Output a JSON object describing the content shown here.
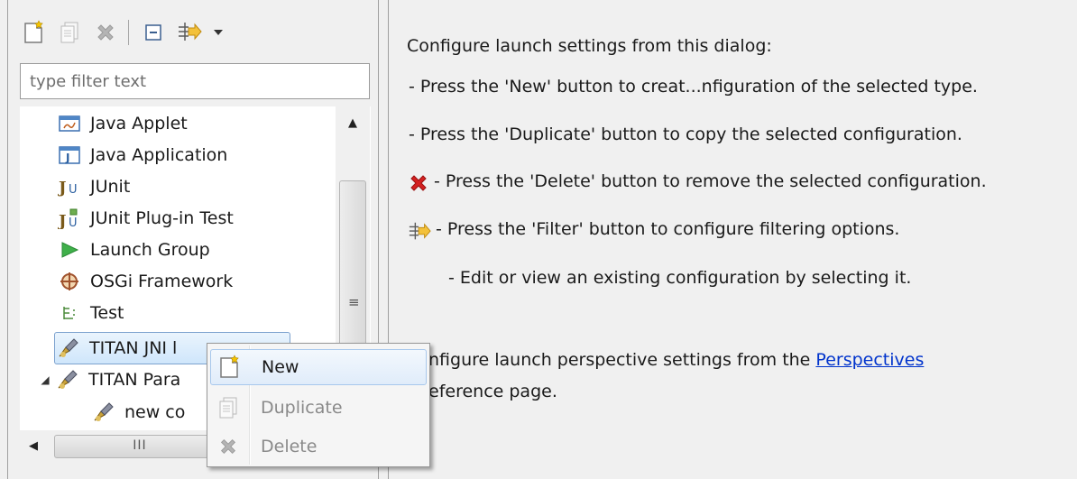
{
  "toolbar": {
    "buttons": [
      "new-config-icon",
      "duplicate-icon",
      "delete-icon",
      "collapse-all-icon",
      "filter-icon",
      "dropdown-arrow-icon"
    ]
  },
  "filter": {
    "placeholder": "type filter text"
  },
  "tree": {
    "items": [
      {
        "label": "Java Applet",
        "icon": "java-applet-icon"
      },
      {
        "label": "Java Application",
        "icon": "java-application-icon"
      },
      {
        "label": "JUnit",
        "icon": "junit-icon"
      },
      {
        "label": "JUnit Plug-in Test",
        "icon": "junit-plugin-icon"
      },
      {
        "label": "Launch Group",
        "icon": "launch-group-icon"
      },
      {
        "label": "OSGi Framework",
        "icon": "osgi-icon"
      },
      {
        "label": "Test",
        "icon": "test-icon"
      },
      {
        "label": "TITAN JNI l",
        "icon": "titan-icon"
      },
      {
        "label": "TITAN Para",
        "icon": "titan-icon"
      },
      {
        "label": "new co",
        "icon": "titan-config-icon"
      }
    ]
  },
  "main": {
    "intro": "Configure launch settings from this dialog:",
    "lines": [
      "- Press the 'New' button to creat...nfiguration of the selected type.",
      "- Press the 'Duplicate' button to copy the selected configuration.",
      "- Press the 'Delete' button to remove the selected configuration.",
      "- Press the 'Filter' button to configure filtering options.",
      "- Edit or view an existing configuration by selecting it."
    ],
    "perspective_prefix": "nfigure launch perspective settings from the ",
    "perspective_link": "Perspectives",
    "perspective_suffix": "eference page."
  },
  "context_menu": {
    "items": [
      {
        "label": "New",
        "icon": "new-config-icon",
        "enabled": true
      },
      {
        "label": "Duplicate",
        "icon": "duplicate-icon",
        "enabled": false
      },
      {
        "label": "Delete",
        "icon": "delete-icon",
        "enabled": false
      }
    ]
  },
  "colors": {
    "selection_border": "#7da2ce",
    "link": "#0033cc",
    "delete_red": "#d42020",
    "panel_bg": "#f0f0f0"
  }
}
